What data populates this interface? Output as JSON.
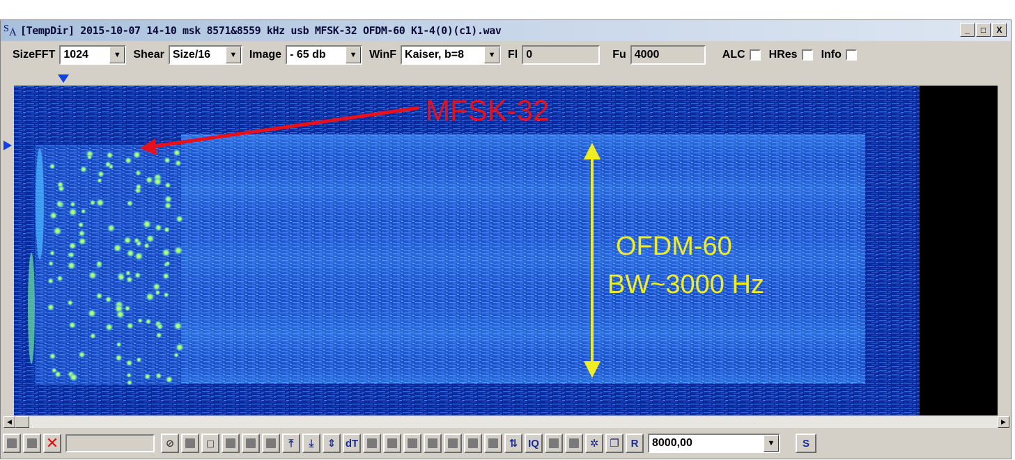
{
  "window": {
    "title": "[TempDir] 2015-10-07 14-10 msk 8571&8559 kHz usb MFSK-32 OFDM-60 K1-4(0)(c1).wav",
    "controls": {
      "minimize": "_",
      "maximize": "□",
      "close": "X"
    }
  },
  "toolbar": {
    "sizefft": {
      "label": "SizeFFT",
      "value": "1024"
    },
    "shear": {
      "label": "Shear",
      "value": "Size/16"
    },
    "image": {
      "label": "Image",
      "value": "- 65 db"
    },
    "winf": {
      "label": "WinF",
      "value": "Kaiser, b=8"
    },
    "fl": {
      "label": "Fl",
      "value": "0"
    },
    "fu": {
      "label": "Fu",
      "value": "4000"
    },
    "alc": {
      "label": "ALC",
      "checked": false
    },
    "hres": {
      "label": "HRes",
      "checked": false
    },
    "info": {
      "label": "Info",
      "checked": false
    }
  },
  "annotations": {
    "mfsk": "MFSK-32",
    "ofdm": "OFDM-60",
    "bw": "BW~3000 Hz"
  },
  "colors": {
    "mfsk_label": "#e8101a",
    "ofdm_label": "#f0ee20",
    "spectrum_bg": "#0a2a9c",
    "marker": "#1040e8"
  },
  "bottombar": {
    "buttons": [
      {
        "icon": "gray-square-icon"
      },
      {
        "icon": "gray-square-icon"
      },
      {
        "icon": "red-x-icon",
        "glyph": "✕"
      },
      {
        "icon": "no-entry-icon",
        "glyph": "⊘"
      },
      {
        "icon": "gray-square-icon"
      },
      {
        "icon": "frame-icon",
        "glyph": "◻"
      },
      {
        "icon": "gray-square-icon"
      },
      {
        "icon": "gray-square-icon"
      },
      {
        "icon": "gray-square-icon"
      },
      {
        "icon": "arrow-up-bar-icon",
        "glyph": "⤒"
      },
      {
        "icon": "arrow-down-bar-icon",
        "glyph": "⤓"
      },
      {
        "icon": "arrows-converge-icon",
        "glyph": "⇕"
      },
      {
        "icon": "dt-icon",
        "glyph": "dT"
      },
      {
        "icon": "gray-square-icon"
      },
      {
        "icon": "gray-square-icon"
      },
      {
        "icon": "gray-square-icon"
      },
      {
        "icon": "gray-square-icon"
      },
      {
        "icon": "gray-square-icon"
      },
      {
        "icon": "gray-square-icon"
      },
      {
        "icon": "gray-square-icon"
      },
      {
        "icon": "swap-vertical-icon",
        "glyph": "⇅"
      },
      {
        "icon": "iq-icon",
        "glyph": "IQ"
      },
      {
        "icon": "gray-square-icon"
      },
      {
        "icon": "gray-square-icon"
      },
      {
        "icon": "globe-icon",
        "glyph": "✲"
      },
      {
        "icon": "copy-icon",
        "glyph": "❐"
      },
      {
        "icon": "r-icon",
        "glyph": "R"
      }
    ],
    "samplerate": "8000,00",
    "s_label": "S"
  }
}
